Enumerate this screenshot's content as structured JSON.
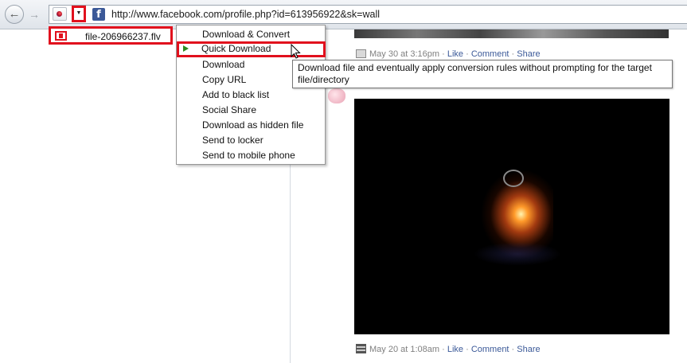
{
  "browser": {
    "url": "http://www.facebook.com/profile.php?id=613956922&sk=wall",
    "back_label": "←",
    "forward_label": "→",
    "favicon_letter": "f",
    "dropdown_arrow": "▼"
  },
  "downloader": {
    "file_name": "file-206966237.flv"
  },
  "context_menu": {
    "items": [
      {
        "label": "Download & Convert"
      },
      {
        "label": "Quick Download",
        "highlighted": true
      },
      {
        "label": "Download"
      },
      {
        "label": "Copy URL"
      },
      {
        "label": "Add to black list"
      },
      {
        "label": "Social Share"
      },
      {
        "label": "Download as hidden file"
      },
      {
        "label": "Send to locker"
      },
      {
        "label": "Send to mobile phone"
      }
    ]
  },
  "tooltip": {
    "text": "Download file and eventually apply conversion rules without prompting for the target file/directory"
  },
  "posts": [
    {
      "timestamp": "May 30 at 3:16pm",
      "separator": " · ",
      "like": "Like",
      "comment": "Comment",
      "share": "Share"
    },
    {
      "timestamp": "May 20 at 1:08am",
      "separator": " · ",
      "like": "Like",
      "comment": "Comment",
      "share": "Share"
    }
  ],
  "colors": {
    "highlight_red": "#e1101d",
    "facebook_blue": "#3b5998",
    "play_green": "#2e8b1e"
  }
}
